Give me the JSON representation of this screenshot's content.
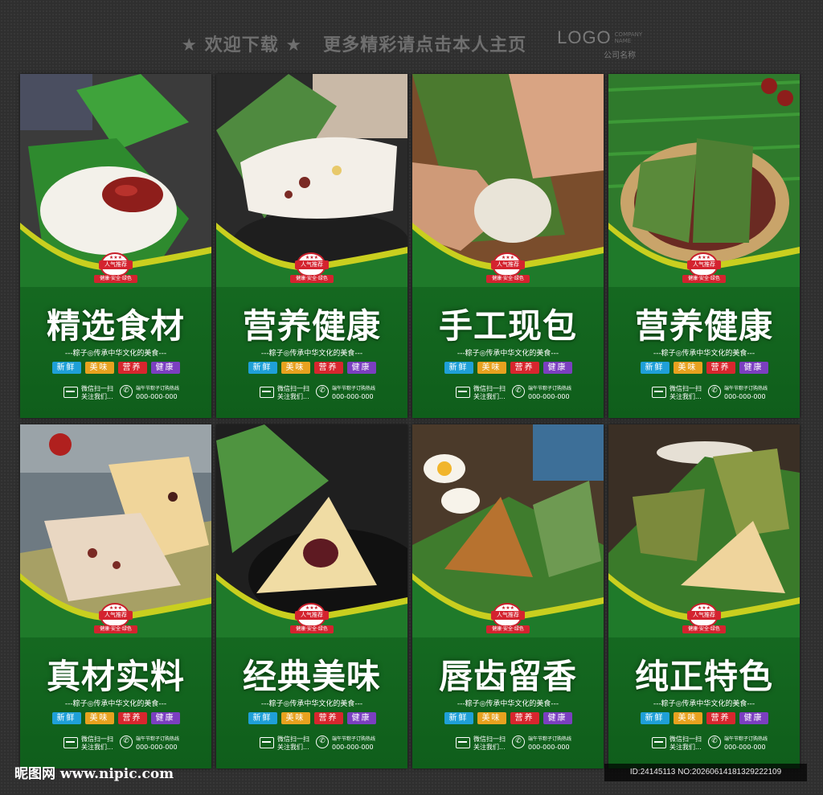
{
  "header": {
    "welcome": "★ 欢迎下载 ★",
    "more": "更多精彩请点击本人主页",
    "logo": "LOGO",
    "logo_sub": "COMPANY NAME",
    "company": "公司名称"
  },
  "cards": [
    {
      "title": "精选食材",
      "subtitle": "---粽子◎传承中华文化的美食---",
      "photo": "rice-dumpling-with-red-date"
    },
    {
      "title": "营养健康",
      "subtitle": "---粽子◎传承中华文化的美食---",
      "photo": "sliced-dumpling-in-bowl"
    },
    {
      "title": "手工现包",
      "subtitle": "---粽子◎传承中华文化的美食---",
      "photo": "hands-wrapping-dumpling"
    },
    {
      "title": "营养健康",
      "subtitle": "---粽子◎传承中华文化的美食---",
      "photo": "dumplings-in-basket-with-beans"
    },
    {
      "title": "真材实料",
      "subtitle": "---粽子◎传承中华文化的美食---",
      "photo": "cut-mixed-grain-dumplings"
    },
    {
      "title": "经典美味",
      "subtitle": "---粽子◎传承中华文化的美食---",
      "photo": "peeled-dumpling-with-bean-paste"
    },
    {
      "title": "唇齿留香",
      "subtitle": "---粽子◎传承中华文化的美食---",
      "photo": "dumpling-with-salted-eggs"
    },
    {
      "title": "纯正特色",
      "subtitle": "---粽子◎传承中华文化的美食---",
      "photo": "tied-dumplings-on-leaves"
    }
  ],
  "badge": {
    "stars": "★★★",
    "label": "人气推荐",
    "tags": "健康·安全·绿色"
  },
  "pills": [
    {
      "label": "新鲜",
      "color": "#1fa0d8"
    },
    {
      "label": "美味",
      "color": "#e8a21f"
    },
    {
      "label": "营养",
      "color": "#d8262e"
    },
    {
      "label": "健康",
      "color": "#7b3fc0"
    }
  ],
  "contact": {
    "wechat_line1": "微信扫一扫",
    "wechat_line2": "关注我们...",
    "phone_line1": "端午节粽子订购热线",
    "phone_number": "000-000-000",
    "phone_glyph": "✆"
  },
  "footer": {
    "site": "昵图网 www.nipic.com",
    "id_line": "ID:24145113 NO:20260614181329222109"
  },
  "colors": {
    "card_green": "#1f7a2a",
    "wave_yellow": "#c9cf1f",
    "badge_red": "#d4232f"
  }
}
